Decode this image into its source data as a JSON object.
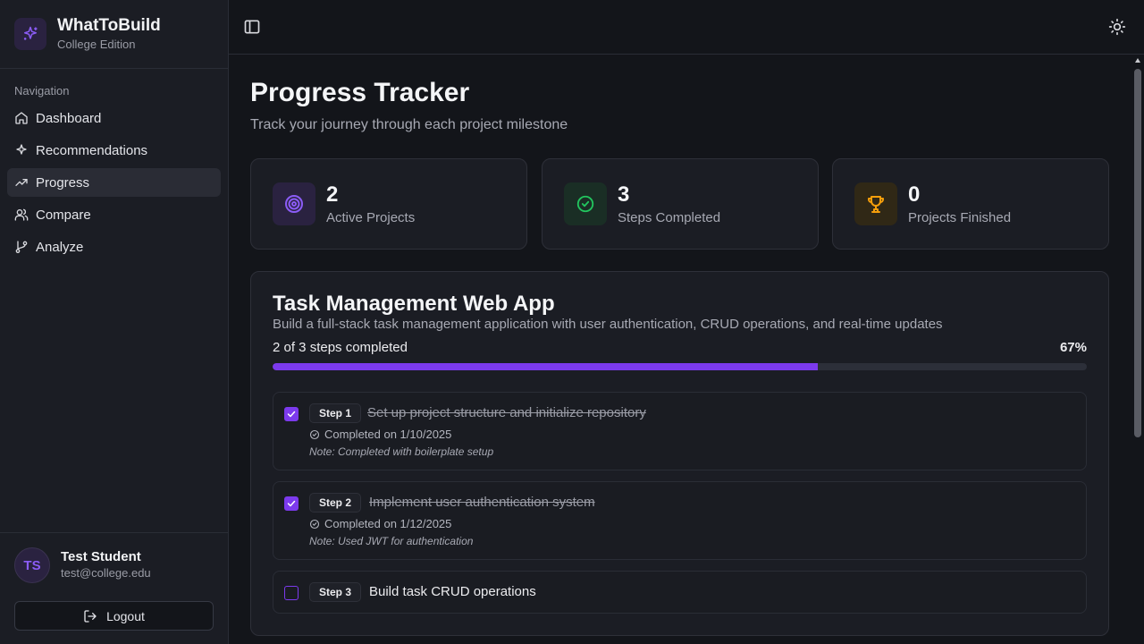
{
  "app": {
    "name": "WhatToBuild",
    "edition": "College Edition"
  },
  "nav": {
    "title": "Navigation",
    "items": [
      {
        "label": "Dashboard",
        "icon": "home-icon"
      },
      {
        "label": "Recommendations",
        "icon": "sparkles-icon"
      },
      {
        "label": "Progress",
        "icon": "trending-up-icon",
        "active": true
      },
      {
        "label": "Compare",
        "icon": "users-icon"
      },
      {
        "label": "Analyze",
        "icon": "git-branch-icon"
      }
    ]
  },
  "user": {
    "initials": "TS",
    "name": "Test Student",
    "email": "test@college.edu",
    "logout_label": "Logout"
  },
  "page": {
    "title": "Progress Tracker",
    "subtitle": "Track your journey through each project milestone"
  },
  "stats": [
    {
      "value": "2",
      "label": "Active Projects",
      "icon": "target-icon",
      "color": "#8b5cf6"
    },
    {
      "value": "3",
      "label": "Steps Completed",
      "icon": "check-circle-icon",
      "color": "#22c55e"
    },
    {
      "value": "0",
      "label": "Projects Finished",
      "icon": "trophy-icon",
      "color": "#f59e0b"
    }
  ],
  "project": {
    "title": "Task Management Web App",
    "description": "Build a full-stack task management application with user authentication, CRUD operations, and real-time updates",
    "progress_text": "2 of 3 steps completed",
    "percent_label": "67%",
    "progress_fraction": 0.67,
    "steps": [
      {
        "badge": "Step 1",
        "title": "Set up project structure and initialize repository",
        "completed": true,
        "date": "Completed on 1/10/2025",
        "note": "Note: Completed with boilerplate setup"
      },
      {
        "badge": "Step 2",
        "title": "Implement user authentication system",
        "completed": true,
        "date": "Completed on 1/12/2025",
        "note": "Note: Used JWT for authentication"
      },
      {
        "badge": "Step 3",
        "title": "Build task CRUD operations",
        "completed": false
      }
    ]
  },
  "colors": {
    "accent": "#7c3aed",
    "success": "#22c55e",
    "warning": "#f59e0b"
  }
}
